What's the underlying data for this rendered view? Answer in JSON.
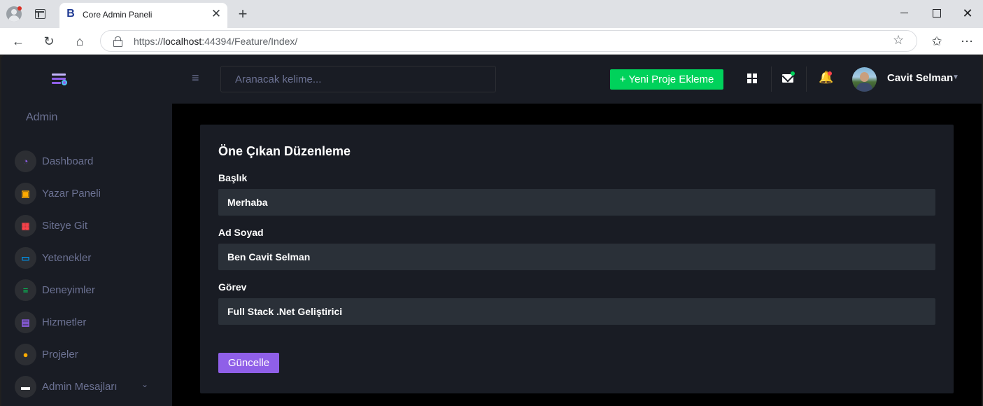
{
  "browser": {
    "tab_title": "Core Admin Paneli",
    "tab_favicon": "B",
    "tab_close": "✕",
    "new_tab": "+",
    "url_prefix": "https://",
    "url_host": "localhost",
    "url_rest": ":44394/Feature/Index/",
    "icons": {
      "back": "←",
      "refresh": "↻",
      "home": "⌂",
      "star": "☆",
      "favorites": "✩",
      "more": "⋯",
      "close": "✕"
    }
  },
  "sidebar": {
    "title": "Admin",
    "items": [
      {
        "label": "Dashboard",
        "icon": "dashboard-icon",
        "glyph": "◔",
        "color": "#8f5fe8"
      },
      {
        "label": "Yazar Paneli",
        "icon": "author-panel-icon",
        "glyph": "▣",
        "color": "#ffab00"
      },
      {
        "label": "Siteye Git",
        "icon": "table-icon",
        "glyph": "▦",
        "color": "#fc424a"
      },
      {
        "label": "Yetenekler",
        "icon": "laptop-icon",
        "glyph": "▭",
        "color": "#0090e7"
      },
      {
        "label": "Deneyimler",
        "icon": "playlist-icon",
        "glyph": "≡",
        "color": "#00d25b"
      },
      {
        "label": "Hizmetler",
        "icon": "contacts-icon",
        "glyph": "▤",
        "color": "#8f5fe8"
      },
      {
        "label": "Projeler",
        "icon": "github-icon",
        "glyph": "●",
        "color": "#ffab00"
      },
      {
        "label": "Admin Mesajları",
        "icon": "message-icon",
        "glyph": "▬",
        "color": "#ffffff",
        "has_caret": true
      }
    ],
    "caret": "⌄"
  },
  "topbar": {
    "menu_glyph": "≡",
    "search_placeholder": "Aranacak kelime...",
    "new_project_label": "+ Yeni Proje Ekleme",
    "bell_glyph": "🔔",
    "user_name": "Cavit Selman",
    "user_caret": "▼"
  },
  "form": {
    "title": "Öne Çıkan Düzenleme",
    "fields": [
      {
        "label": "Başlık",
        "value": "Merhaba"
      },
      {
        "label": "Ad Soyad",
        "value": "Ben Cavit Selman"
      },
      {
        "label": "Görev",
        "value": "Full Stack .Net Geliştirici"
      }
    ],
    "submit_label": "Güncelle"
  },
  "colors": {
    "primary": "#8f5fe8",
    "success": "#00d25b",
    "danger": "#fc424a",
    "sidebar_bg": "#191c24",
    "input_bg": "#2a3038"
  }
}
